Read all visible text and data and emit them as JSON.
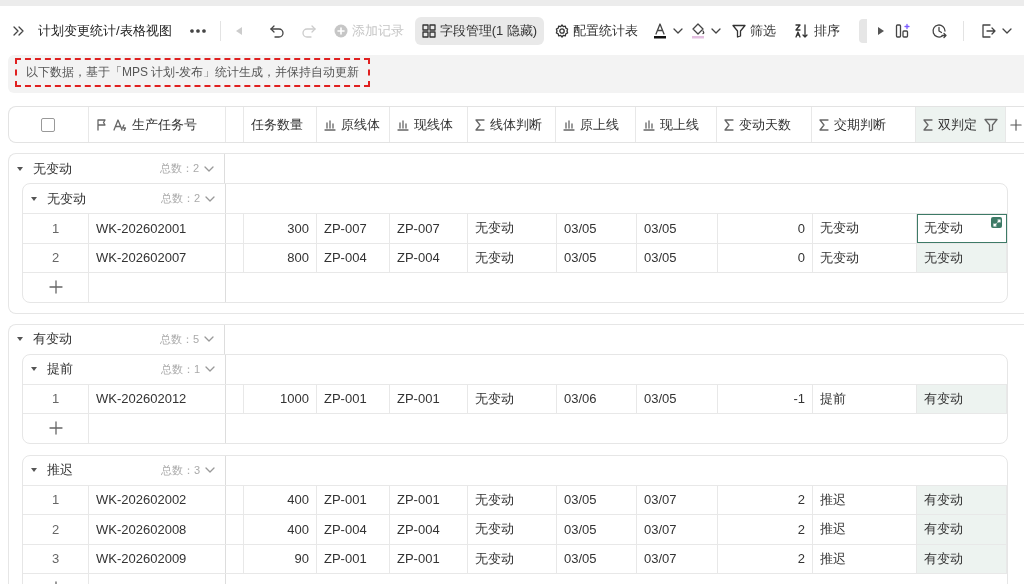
{
  "breadcrumb": {
    "title": "计划变更统计/表格视图"
  },
  "toolbar": {
    "buttons": [
      {
        "label": "添加记录",
        "disabled": true,
        "active": false
      },
      {
        "label": "字段管理(1 隐藏)",
        "disabled": false,
        "active": true
      },
      {
        "label": "配置统计表",
        "disabled": false,
        "active": false
      },
      {
        "label": "筛选",
        "disabled": false,
        "active": false
      },
      {
        "label": "排序",
        "disabled": false,
        "active": false
      }
    ]
  },
  "notice": {
    "text": "以下数据，基于「MPS 计划-发布」统计生成，并保持自动更新"
  },
  "table": {
    "header_checkbox": {
      "checked": false
    },
    "columns": [
      {
        "label": "生产任务号",
        "kind": "primary",
        "numeric": false,
        "selected": false,
        "filtered": false
      },
      {
        "label": "任务数量",
        "kind": "number",
        "numeric": true,
        "selected": false,
        "filtered": false
      },
      {
        "label": "原线体",
        "kind": "lookup",
        "numeric": false,
        "selected": false,
        "filtered": false
      },
      {
        "label": "现线体",
        "kind": "lookup",
        "numeric": false,
        "selected": false,
        "filtered": false
      },
      {
        "label": "线体判断",
        "kind": "formula",
        "numeric": false,
        "selected": false,
        "filtered": false
      },
      {
        "label": "原上线",
        "kind": "lookup",
        "numeric": false,
        "selected": false,
        "filtered": false
      },
      {
        "label": "现上线",
        "kind": "lookup",
        "numeric": false,
        "selected": false,
        "filtered": false
      },
      {
        "label": "变动天数",
        "kind": "formula",
        "numeric": true,
        "selected": false,
        "filtered": false
      },
      {
        "label": "交期判断",
        "kind": "formula",
        "numeric": false,
        "selected": false,
        "filtered": false
      },
      {
        "label": "双判定",
        "kind": "formula",
        "numeric": false,
        "selected": true,
        "filtered": true
      }
    ],
    "groups": [
      {
        "label": "无变动",
        "count": "总数：2",
        "expanded": true,
        "children": [
          {
            "label": "无变动",
            "count": "总数：2",
            "expanded": true,
            "rows": [
              {
                "index": "1",
                "focused": true,
                "cells": [
                  "WK-202602001",
                  "300",
                  "ZP-007",
                  "ZP-007",
                  "无变动",
                  "03/05",
                  "03/05",
                  "0",
                  "无变动",
                  "无变动"
                ]
              },
              {
                "index": "2",
                "focused": false,
                "cells": [
                  "WK-202602007",
                  "800",
                  "ZP-004",
                  "ZP-004",
                  "无变动",
                  "03/05",
                  "03/05",
                  "0",
                  "无变动",
                  "无变动"
                ]
              }
            ]
          }
        ]
      },
      {
        "label": "有变动",
        "count": "总数：5",
        "expanded": true,
        "children": [
          {
            "label": "提前",
            "count": "总数：1",
            "expanded": true,
            "rows": [
              {
                "index": "1",
                "focused": false,
                "cells": [
                  "WK-202602012",
                  "1000",
                  "ZP-001",
                  "ZP-001",
                  "无变动",
                  "03/06",
                  "03/05",
                  "-1",
                  "提前",
                  "有变动"
                ]
              }
            ]
          },
          {
            "label": "推迟",
            "count": "总数：3",
            "expanded": true,
            "rows": [
              {
                "index": "1",
                "focused": false,
                "cells": [
                  "WK-202602002",
                  "400",
                  "ZP-001",
                  "ZP-001",
                  "无变动",
                  "03/05",
                  "03/07",
                  "2",
                  "推迟",
                  "有变动"
                ]
              },
              {
                "index": "2",
                "focused": false,
                "cells": [
                  "WK-202602008",
                  "400",
                  "ZP-004",
                  "ZP-004",
                  "无变动",
                  "03/05",
                  "03/07",
                  "2",
                  "推迟",
                  "有变动"
                ]
              },
              {
                "index": "3",
                "focused": false,
                "cells": [
                  "WK-202602009",
                  "90",
                  "ZP-001",
                  "ZP-001",
                  "无变动",
                  "03/05",
                  "03/07",
                  "2",
                  "推迟",
                  "有变动"
                ]
              }
            ]
          }
        ]
      }
    ]
  }
}
